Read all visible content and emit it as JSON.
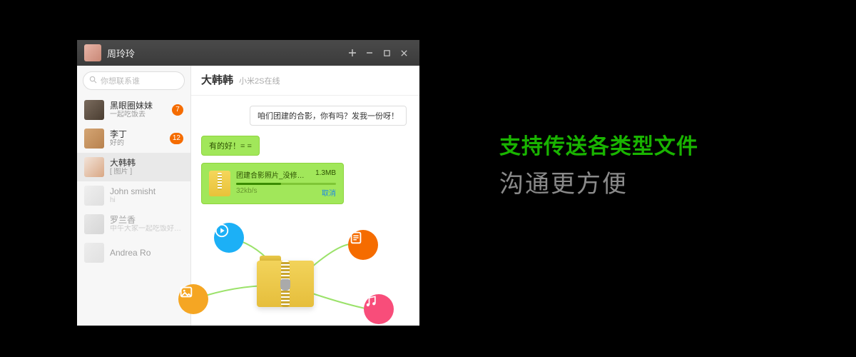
{
  "titlebar": {
    "username": "周玲玲"
  },
  "search": {
    "placeholder": "你想联系谁"
  },
  "contacts": [
    {
      "name": "黑眼圈妹妹",
      "sub": "一起吃饭去",
      "badge": "7"
    },
    {
      "name": "李丁",
      "sub": "好的",
      "badge": "12"
    },
    {
      "name": "大韩韩",
      "sub": "[ 图片 ]",
      "badge": ""
    },
    {
      "name": "John smisht",
      "sub": "hi",
      "badge": ""
    },
    {
      "name": "罗兰香",
      "sub": "中午大家一起吃饭好不…",
      "badge": ""
    },
    {
      "name": "Andrea Ro",
      "sub": "",
      "badge": ""
    }
  ],
  "chat": {
    "title": "大韩韩",
    "status": "小米2S在线",
    "incoming": "咱们团建的合影，你有吗？发我一份呀！",
    "outgoing": "有的好！= =",
    "file": {
      "name": "团建合影照片_没修改.zip",
      "size": "1.3MB",
      "speed": "32kb/s",
      "cancel": "取消"
    }
  },
  "marketing": {
    "line1": "支持传送各类型文件",
    "line2": "沟通更方便"
  }
}
